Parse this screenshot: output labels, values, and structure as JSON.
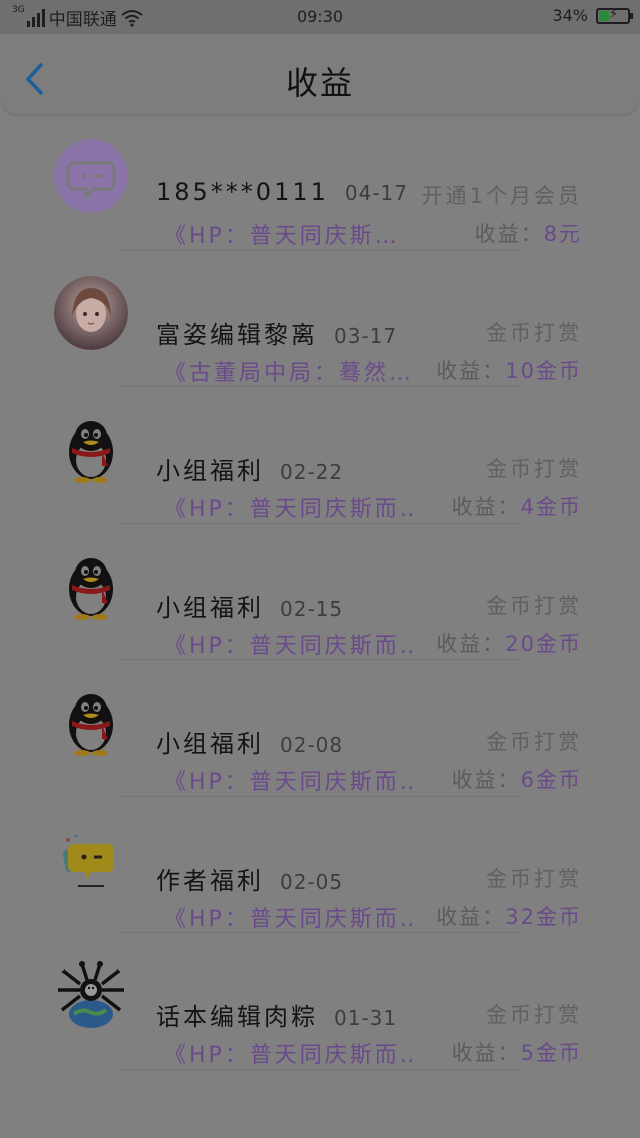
{
  "status_bar": {
    "network": "3G",
    "carrier": "中国联通",
    "time": "09:30",
    "battery": "34%",
    "battery_level": 0.34
  },
  "header": {
    "title": "收益"
  },
  "items": [
    {
      "avatar": "chat-bubble-avatar",
      "name": "185***0111",
      "date": "04-17",
      "type": "开通1个月会员",
      "book": "《HP：普天同庆斯…",
      "income_label": "收益：",
      "amount": "8元"
    },
    {
      "avatar": "girl-portrait-avatar",
      "name": "富姿编辑黎离",
      "date": "03-17",
      "type": "金币打赏",
      "book": "《古董局中局：蓦然…",
      "income_label": "收益：",
      "amount": "10金币"
    },
    {
      "avatar": "penguin-avatar",
      "name": "小组福利",
      "date": "02-22",
      "type": "金币打赏",
      "book": "《HP：普天同庆斯而…",
      "income_label": "收益：",
      "amount": "4金币"
    },
    {
      "avatar": "penguin-avatar",
      "name": "小组福利",
      "date": "02-15",
      "type": "金币打赏",
      "book": "《HP：普天同庆斯而…",
      "income_label": "收益：",
      "amount": "20金币"
    },
    {
      "avatar": "penguin-avatar",
      "name": "小组福利",
      "date": "02-08",
      "type": "金币打赏",
      "book": "《HP：普天同庆斯而…",
      "income_label": "收益：",
      "amount": "6金币"
    },
    {
      "avatar": "yellow-chat-avatar",
      "name": "作者福利",
      "date": "02-05",
      "type": "金币打赏",
      "book": "《HP：普天同庆斯而…",
      "income_label": "收益：",
      "amount": "32金币"
    },
    {
      "avatar": "spider-globe-avatar",
      "name": "话本编辑肉粽",
      "date": "01-31",
      "type": "金币打赏",
      "book": "《HP：普天同庆斯而…",
      "income_label": "收益：",
      "amount": "5金币"
    }
  ]
}
